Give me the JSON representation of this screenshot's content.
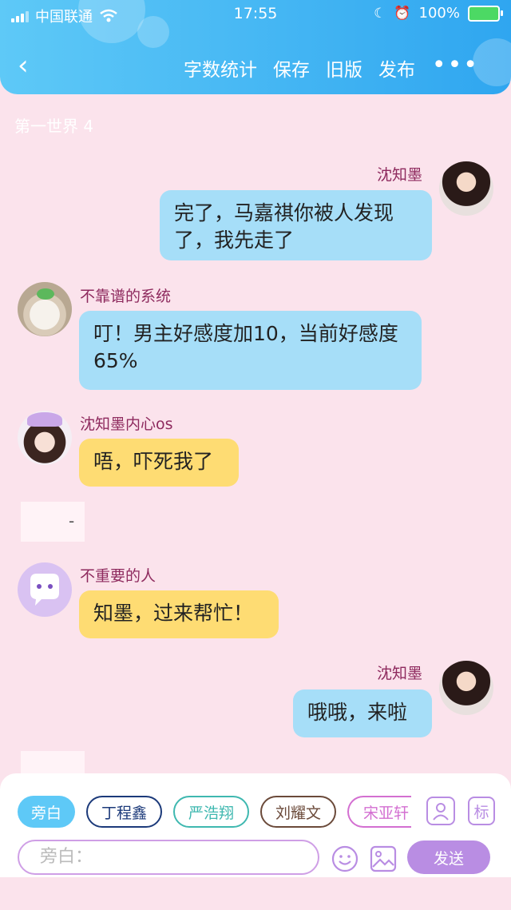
{
  "status_bar": {
    "carrier": "中国联通",
    "time": "17:55",
    "battery": "100%"
  },
  "nav": {
    "back_icon": "chevron-left-icon",
    "items": [
      "字数统计",
      "保存",
      "旧版",
      "发布"
    ],
    "more": "•••"
  },
  "world_title": "第一世界 4",
  "messages": [
    {
      "side": "right",
      "name": "沈知墨",
      "text": "完了，马嘉祺你被人发现了，我先走了",
      "color": "blue"
    },
    {
      "side": "left",
      "name": "不靠谱的系统",
      "text": "叮！男主好感度加10，当前好感度65%",
      "color": "blue"
    },
    {
      "side": "left",
      "name": "沈知墨内心os",
      "text": "唔，吓死我了",
      "color": "yellow"
    },
    {
      "side": "left",
      "name": "不重要的人",
      "text": "知墨，过来帮忙！",
      "color": "yellow"
    },
    {
      "side": "right",
      "name": "沈知墨",
      "text": "哦哦，来啦",
      "color": "blue"
    }
  ],
  "divider_dash": "-",
  "role_chips": [
    "旁白",
    "丁程鑫",
    "严浩翔",
    "刘耀文",
    "宋亚轩"
  ],
  "mark_label": "标",
  "input": {
    "placeholder": "旁白："
  },
  "send_label": "发送",
  "colors": {
    "accent": "#2fa6f0",
    "bubble_blue": "#a6def8",
    "bubble_yellow": "#fedc73",
    "name": "#8e2a5e",
    "send": "#b98de3"
  }
}
